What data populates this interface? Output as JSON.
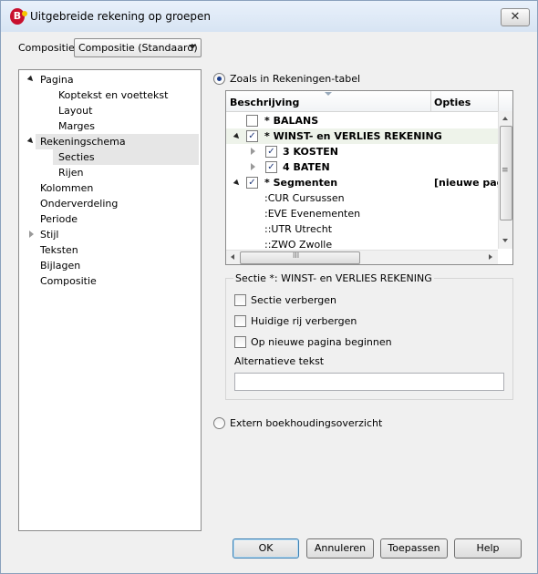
{
  "window": {
    "title": "Uitgebreide rekening op groepen",
    "close_glyph": "✕",
    "icon_letter": "B"
  },
  "composition": {
    "label": "Compositie:",
    "value": "Compositie (Standaard)"
  },
  "nav": {
    "items": [
      {
        "label": "Pagina"
      },
      {
        "label": "Koptekst en voettekst"
      },
      {
        "label": "Layout"
      },
      {
        "label": "Marges"
      },
      {
        "label": "Rekeningschema"
      },
      {
        "label": "Secties"
      },
      {
        "label": "Rijen"
      },
      {
        "label": "Kolommen"
      },
      {
        "label": "Onderverdeling"
      },
      {
        "label": "Periode"
      },
      {
        "label": "Stijl"
      },
      {
        "label": "Teksten"
      },
      {
        "label": "Bijlagen"
      },
      {
        "label": "Compositie"
      }
    ]
  },
  "options": {
    "accounts_table": {
      "label": "Zoals in Rekeningen-tabel",
      "selected": true
    },
    "external": {
      "label": "Extern boekhoudingsoverzicht",
      "selected": false
    }
  },
  "table": {
    "columns": [
      "Beschrijving",
      "Opties"
    ],
    "rows": [
      {
        "text": "* BALANS",
        "checked": false,
        "options": ""
      },
      {
        "text": "* WINST- en VERLIES REKENING",
        "checked": true,
        "options": ""
      },
      {
        "text": "3 KOSTEN",
        "checked": true,
        "options": ""
      },
      {
        "text": "4 BATEN",
        "checked": true,
        "options": ""
      },
      {
        "text": "* Segmenten",
        "checked": true,
        "options": "[nieuwe pagi"
      },
      {
        "text": ":CUR Cursussen"
      },
      {
        "text": ":EVE Evenementen"
      },
      {
        "text": "::UTR Utrecht"
      },
      {
        "text": "::ZWO Zwolle"
      }
    ],
    "scroll_glyph": "≡",
    "hscroll_glyph": "III"
  },
  "section": {
    "title": "Sectie *: WINST- en VERLIES REKENING",
    "hide_section": "Sectie verbergen",
    "hide_row": "Huidige rij verbergen",
    "new_page": "Op nieuwe pagina beginnen",
    "alt_text_label": "Alternatieve tekst",
    "alt_text_value": ""
  },
  "buttons": {
    "ok": "OK",
    "cancel": "Annuleren",
    "apply": "Toepassen",
    "help": "Help"
  }
}
